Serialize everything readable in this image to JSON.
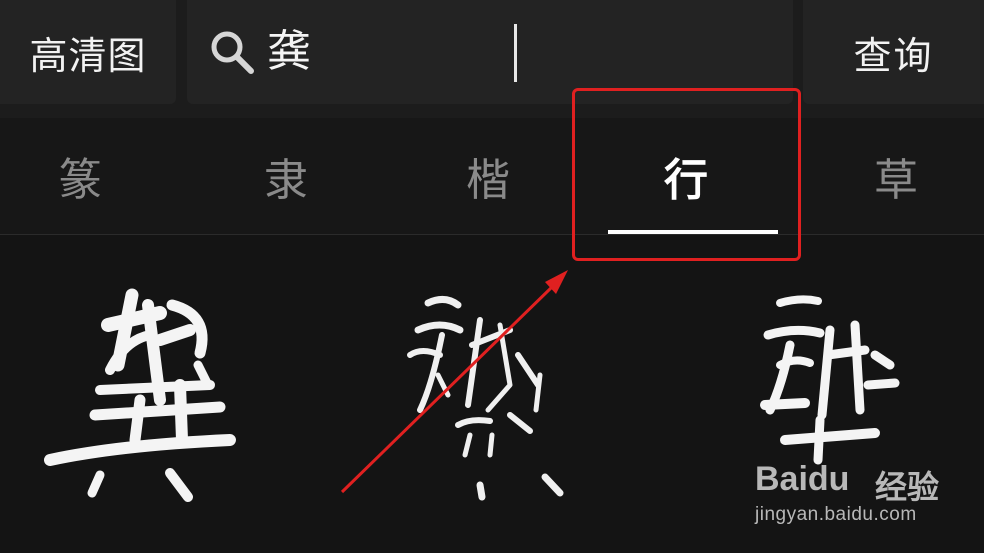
{
  "toolbar": {
    "hd_label": "高清图",
    "search_value": "龚",
    "query_label": "查询"
  },
  "tabs": [
    {
      "label": "篆",
      "active": false
    },
    {
      "label": "隶",
      "active": false
    },
    {
      "label": "楷",
      "active": false
    },
    {
      "label": "行",
      "active": true
    },
    {
      "label": "草",
      "active": false
    }
  ],
  "annotation": {
    "highlight_color": "#e02020"
  },
  "watermark": {
    "brand": "Baidu",
    "suffix": "经验",
    "url": "jingyan.baidu.com"
  }
}
